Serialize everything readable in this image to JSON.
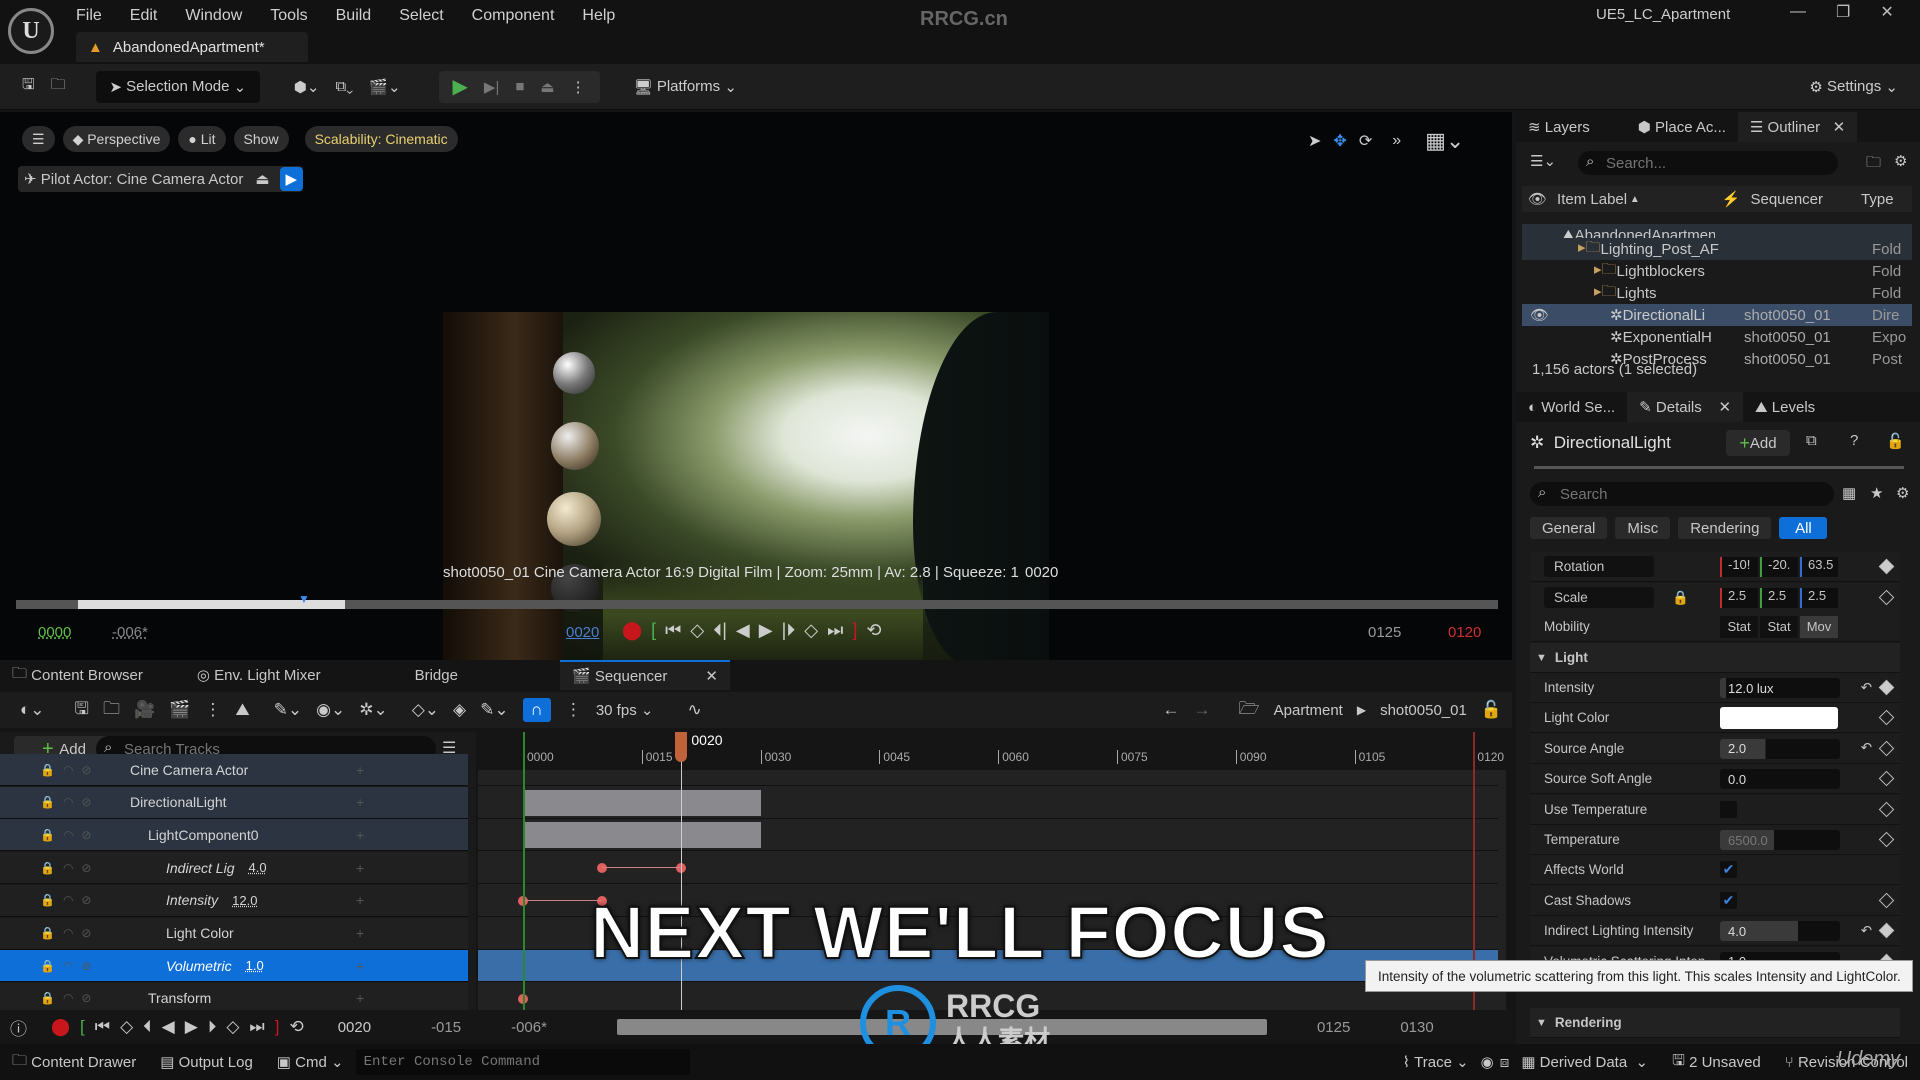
{
  "app": {
    "watermark": "RRCG.cn",
    "project": "UE5_LC_Apartment",
    "doc_tab": "AbandonedApartment*",
    "logo": "U"
  },
  "menu": [
    "File",
    "Edit",
    "Window",
    "Tools",
    "Build",
    "Select",
    "Component",
    "Help"
  ],
  "toolbar": {
    "selection_mode": "Selection Mode",
    "platforms": "Platforms",
    "settings": "Settings"
  },
  "viewport": {
    "perspective": "Perspective",
    "lit": "Lit",
    "show": "Show",
    "scalability": "Scalability: Cinematic",
    "pilot": "Pilot Actor: Cine Camera Actor",
    "overlay": "shot0050_01 Cine Camera Actor 16:9 Digital Film | Zoom: 25mm | Av: 2.8 | Squeeze: 1",
    "overlay_frame": "0020",
    "start": "0000",
    "offset": "-006*",
    "current": "0020",
    "end": "0125",
    "end_red": "0120",
    "scrub_progress": 0.15
  },
  "bottom_tabs": [
    "Content Browser",
    "Env. Light Mixer",
    "Bridge",
    "Sequencer"
  ],
  "sequencer": {
    "fps": "30 fps",
    "breadcrumb": [
      "Apartment",
      "shot0050_01"
    ],
    "add": "Add",
    "search_placeholder": "Search Tracks",
    "playhead": "0020",
    "playhead_frame": 20,
    "ticks": [
      "0000",
      "0015",
      "0030",
      "0045",
      "0060",
      "0075",
      "0090",
      "0105",
      "0120"
    ],
    "tracks": [
      {
        "label": "Cine Camera Actor",
        "indent": 1,
        "italic": false,
        "value": ""
      },
      {
        "label": "DirectionalLight",
        "indent": 1,
        "italic": false,
        "value": ""
      },
      {
        "label": "LightComponent0",
        "indent": 2,
        "italic": false,
        "value": ""
      },
      {
        "label": "Indirect Lig",
        "indent": 3,
        "italic": true,
        "value": "4.0",
        "keys": [
          10,
          20
        ]
      },
      {
        "label": "Intensity",
        "indent": 3,
        "italic": true,
        "value": "12.0",
        "keys": [
          0,
          10
        ]
      },
      {
        "label": "Light Color",
        "indent": 3,
        "italic": false,
        "value": ""
      },
      {
        "label": "Volumetric",
        "indent": 3,
        "italic": true,
        "value": "1.0",
        "selected": true
      },
      {
        "label": "Transform",
        "indent": 2,
        "italic": false,
        "value": "",
        "keys": [
          0
        ]
      }
    ],
    "section_frames": [
      0,
      30
    ],
    "bottom": {
      "current": "0020",
      "a": "-015",
      "b": "-006*",
      "c": "0125",
      "d": "0130"
    }
  },
  "caption": "NEXT WE'LL FOCUS",
  "outliner": {
    "tabs": [
      "Layers",
      "Place Ac...",
      "Outliner"
    ],
    "search_placeholder": "Search...",
    "cols": [
      "Item Label",
      "Sequencer",
      "Type"
    ],
    "rows": [
      {
        "label": "AbandonedApartment (Editor)",
        "seq": "",
        "type": "",
        "indent": 0
      },
      {
        "label": "Lighting_Post_AF",
        "seq": "",
        "type": "Fold",
        "indent": 1
      },
      {
        "label": "Lightblockers",
        "seq": "",
        "type": "Fold",
        "indent": 2
      },
      {
        "label": "Lights",
        "seq": "",
        "type": "Fold",
        "indent": 2
      },
      {
        "label": "DirectionalLi",
        "seq": "shot0050_01",
        "type": "Dire",
        "indent": 3,
        "selected": true
      },
      {
        "label": "ExponentialH",
        "seq": "shot0050_01",
        "type": "Expo",
        "indent": 3
      },
      {
        "label": "PostProcess",
        "seq": "shot0050_01",
        "type": "Post",
        "indent": 3
      }
    ],
    "footer": "1,156 actors (1 selected)"
  },
  "details": {
    "tabs": [
      "World Se...",
      "Details",
      "Levels"
    ],
    "title": "DirectionalLight",
    "add": "Add",
    "search_placeholder": "Search",
    "filters": [
      "General",
      "Misc",
      "Rendering",
      "All"
    ],
    "rotation": {
      "label": "Rotation",
      "x": "-10!",
      "y": "-20.",
      "z": "63.5"
    },
    "scale": {
      "label": "Scale",
      "x": "2.5",
      "y": "2.5",
      "z": "2.5"
    },
    "mobility": {
      "label": "Mobility",
      "opts": [
        "Stat",
        "Stat",
        "Mov"
      ]
    },
    "section_light": "Light",
    "props": [
      {
        "label": "Intensity",
        "value": "12.0 lux",
        "type": "num",
        "fill": 0.05
      },
      {
        "label": "Light Color",
        "value": "",
        "type": "color",
        "color": "#ffffff"
      },
      {
        "label": "Source Angle",
        "value": "2.0",
        "type": "num",
        "fill": 0.38
      },
      {
        "label": "Source Soft Angle",
        "value": "0.0",
        "type": "num",
        "fill": 0
      },
      {
        "label": "Use Temperature",
        "type": "check",
        "checked": false
      },
      {
        "label": "Temperature",
        "value": "6500.0",
        "type": "num",
        "fill": 0.45
      },
      {
        "label": "Affects World",
        "type": "check",
        "checked": true
      },
      {
        "label": "Cast Shadows",
        "type": "check",
        "checked": true
      },
      {
        "label": "Indirect Lighting Intensity",
        "value": "4.0",
        "type": "num",
        "fill": 0.65
      },
      {
        "label": "Volumetric Scattering Inten...",
        "value": "1.0",
        "type": "num",
        "fill": 0
      }
    ],
    "section_rendering": "Rendering",
    "tooltip": "Intensity of the volumetric scattering from this light.  This scales Intensity and LightColor."
  },
  "status": {
    "content_drawer": "Content Drawer",
    "output_log": "Output Log",
    "cmd": "Cmd",
    "console_placeholder": "Enter Console Command",
    "trace": "Trace",
    "derived": "Derived Data",
    "unsaved": "2 Unsaved",
    "revision": "Revision Control"
  },
  "brand": {
    "rrcg": "RRCG",
    "rrcg_sub": "人人素材",
    "udemy": "Udemy"
  },
  "colors": {
    "accent": "#0e6fd8",
    "play": "#4caf50",
    "record": "#c8161d",
    "playhead": "#c0623a",
    "scalability": "#e8d070"
  }
}
